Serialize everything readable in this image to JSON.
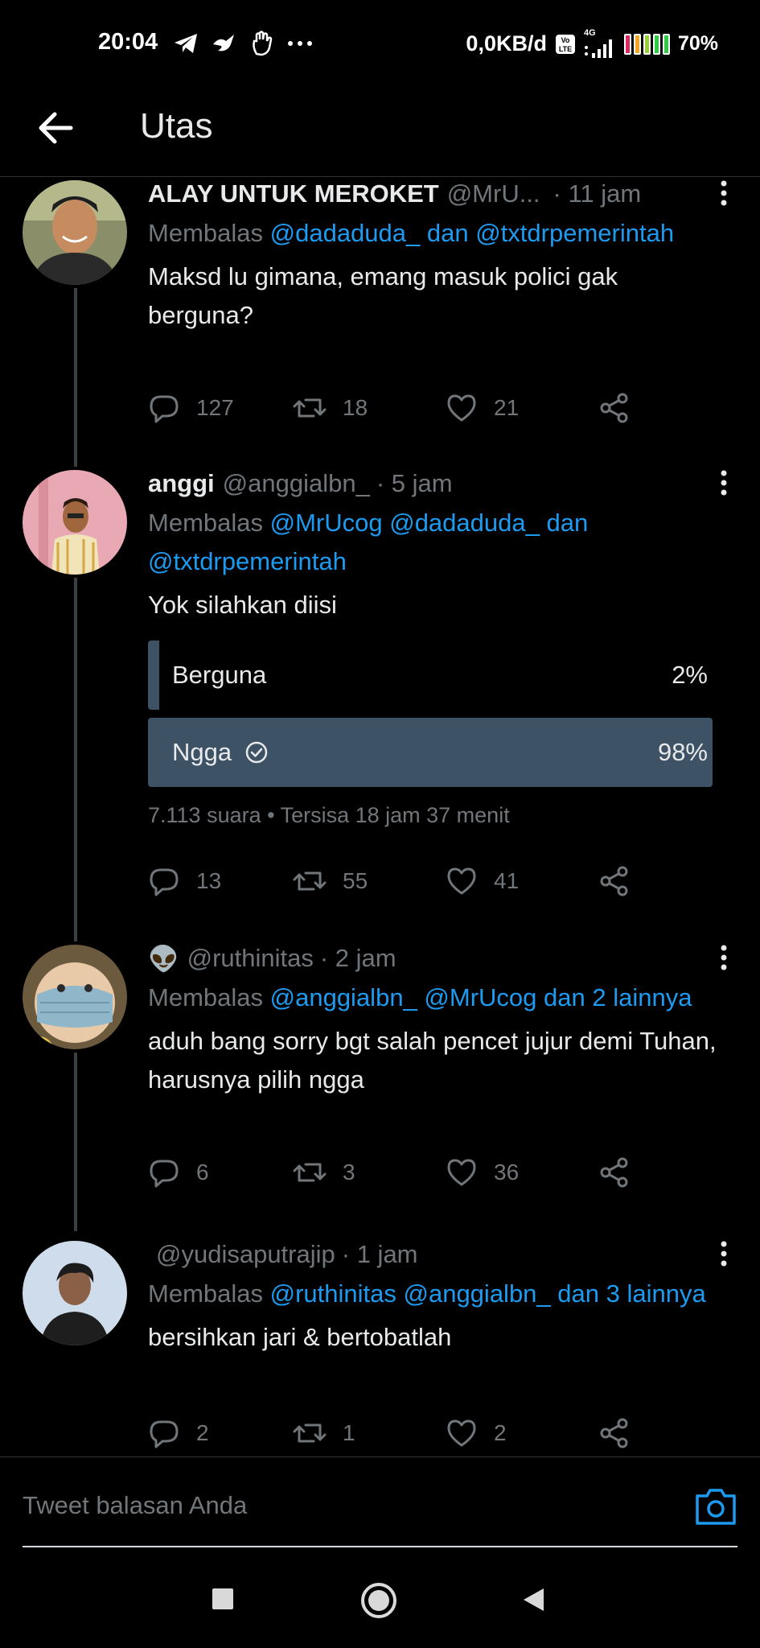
{
  "status_bar": {
    "time": "20:04",
    "network_speed": "0,0KB/d",
    "network_type": "4G",
    "battery_percent": "70%",
    "icons": [
      "telegram-icon",
      "bird-icon",
      "hand-icon",
      "more-dots-icon",
      "volte-icon",
      "signal-icon",
      "battery-icon"
    ]
  },
  "header": {
    "title": "Utas",
    "back_icon": "arrow-left-icon"
  },
  "tweets": [
    {
      "display_name": "ALAY UNTUK MEROKET",
      "handle": "@MrU...",
      "time": "· 11 jam",
      "reply_prefix": "Membalas",
      "reply_mentions": "@dadaduda_ dan @txtdrpemerintah",
      "text": "Maksd lu gimana, emang masuk polici gak berguna?",
      "replies": "127",
      "retweets": "18",
      "likes": "21"
    },
    {
      "display_name": "anggi",
      "handle": "@anggialbn_",
      "time": "· 5 jam",
      "reply_prefix": "Membalas",
      "reply_mentions": "@MrUcog @dadaduda_ dan @txtdrpemerintah",
      "text": "Yok silahkan diisi",
      "poll": {
        "options": [
          {
            "label": "Berguna",
            "percent_text": "2%",
            "percent": 0.02,
            "selected": false
          },
          {
            "label": "Ngga",
            "percent_text": "98%",
            "percent": 0.98,
            "selected": true
          }
        ],
        "meta": "7.113 suara • Tersisa 18 jam 37 menit"
      },
      "replies": "13",
      "retweets": "55",
      "likes": "41"
    },
    {
      "display_name": "👽",
      "handle": "@ruthinitas",
      "time": "· 2 jam",
      "reply_prefix": "Membalas",
      "reply_mentions": "@anggialbn_ @MrUcog dan 2 lainnya",
      "text": "aduh bang sorry bgt salah pencet jujur demi Tuhan, harusnya pilih ngga",
      "replies": "6",
      "retweets": "3",
      "likes": "36"
    },
    {
      "display_name": "",
      "handle": "@yudisaputrajip",
      "time": "· 1 jam",
      "reply_prefix": "Membalas",
      "reply_mentions": "@ruthinitas @anggialbn_ dan 3 lainnya",
      "text": "bersihkan jari & bertobatlah",
      "replies": "2",
      "retweets": "1",
      "likes": "2"
    }
  ],
  "reply_bar": {
    "placeholder": "Tweet balasan Anda"
  },
  "colors": {
    "background": "#000000",
    "text_primary": "#e7e9ea",
    "text_secondary": "#71767b",
    "link": "#1d9bf0",
    "poll_fill": "#3e5266",
    "divider": "#2f3336"
  }
}
